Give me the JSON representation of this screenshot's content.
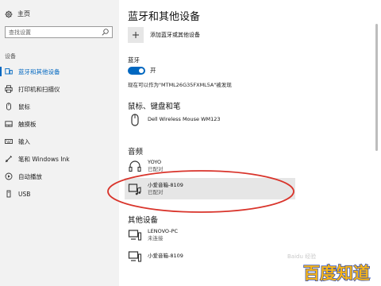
{
  "sidebar": {
    "home_label": "主页",
    "search_placeholder": "查找设置",
    "section_label": "设备",
    "items": [
      {
        "label": "蓝牙和其他设备",
        "icon": "bluetooth-devices-icon",
        "active": true
      },
      {
        "label": "打印机和扫描仪",
        "icon": "printer-icon",
        "active": false
      },
      {
        "label": "鼠标",
        "icon": "mouse-icon",
        "active": false
      },
      {
        "label": "触摸板",
        "icon": "touchpad-icon",
        "active": false
      },
      {
        "label": "输入",
        "icon": "keyboard-icon",
        "active": false
      },
      {
        "label": "笔和 Windows Ink",
        "icon": "pen-icon",
        "active": false
      },
      {
        "label": "自动播放",
        "icon": "autoplay-icon",
        "active": false
      },
      {
        "label": "USB",
        "icon": "usb-icon",
        "active": false
      }
    ]
  },
  "main": {
    "title": "蓝牙和其他设备",
    "add_device_label": "添加蓝牙或其他设备",
    "bluetooth": {
      "label": "蓝牙",
      "toggle_state": "开",
      "discoverable_text": "现在可以作为\"MTML26G35FXML5A\"被发现"
    },
    "groups": {
      "mouse_keyboard_pen": {
        "header": "鼠标、键盘和笔",
        "devices": [
          {
            "name": "Dell Wireless Mouse WM123",
            "status": ""
          }
        ]
      },
      "audio": {
        "header": "音频",
        "devices": [
          {
            "name": "YOYO",
            "status": "已配对"
          },
          {
            "name": "小爱音箱-8109",
            "status": "已配对"
          }
        ]
      },
      "other": {
        "header": "其他设备",
        "devices": [
          {
            "name": "LENOVO-PC",
            "status": "未连接"
          },
          {
            "name": "小爱音箱-8109",
            "status": ""
          }
        ]
      }
    }
  },
  "overlay": {
    "watermark": "Baidu 经验",
    "logo_text": "百度知道",
    "annotation_color": "#d9342b"
  },
  "colors": {
    "accent": "#0067c0",
    "sidebar_bg": "#f2f2f2",
    "selected_bg": "#e6e6e6",
    "logo_yellow": "#f5b41a",
    "logo_blue": "#2a4bb8"
  }
}
